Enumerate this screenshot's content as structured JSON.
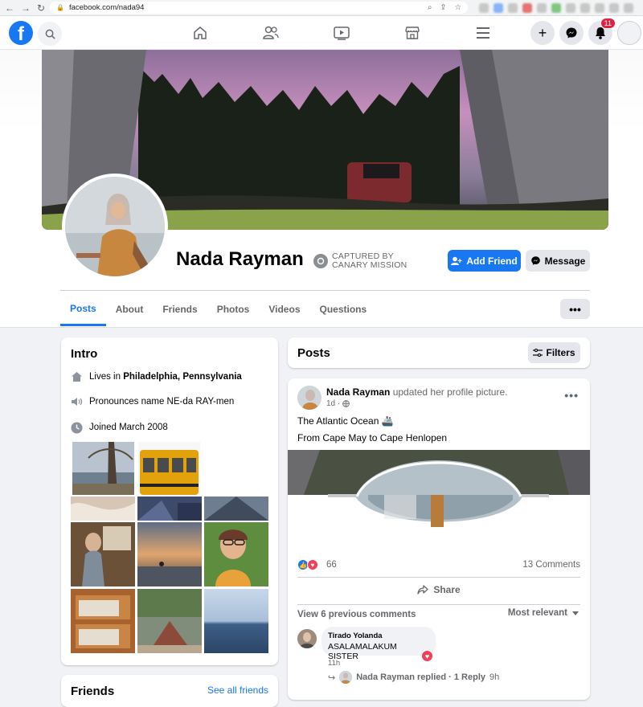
{
  "browser": {
    "url": "facebook.com/nada94"
  },
  "header": {
    "logo": "f",
    "notifications_count": "11"
  },
  "profile": {
    "name": "Nada Rayman",
    "captured_line1": "CAPTURED BY",
    "captured_line2": "CANARY MISSION",
    "add_friend_label": "Add Friend",
    "message_label": "Message"
  },
  "tabs": [
    {
      "label": "Posts",
      "active": true
    },
    {
      "label": "About"
    },
    {
      "label": "Friends"
    },
    {
      "label": "Photos"
    },
    {
      "label": "Videos"
    },
    {
      "label": "Questions"
    }
  ],
  "more_label": "•••",
  "intro": {
    "title": "Intro",
    "lives_prefix": "Lives in ",
    "lives_place": "Philadelphia, Pennsylvania",
    "pronounces": "Pronounces name NE-da RAY-men",
    "joined": "Joined March 2008"
  },
  "friends_section": {
    "title": "Friends",
    "see_all": "See all friends"
  },
  "posts": {
    "title": "Posts",
    "filters_label": "Filters"
  },
  "post": {
    "author": "Nada Rayman",
    "action": " updated her profile picture.",
    "time": "1d ·",
    "line1": "The Atlantic Ocean 🚢",
    "line2": "From Cape May to Cape Henlopen",
    "reaction_count": "66",
    "comments_count": "13 Comments",
    "share_label": "Share",
    "view_previous": "View 6 previous comments",
    "sort_label": "Most relevant",
    "comment": {
      "author": "Tirado Yolanda",
      "text": "ASALAMALAKUM SISTER",
      "time": "11h"
    },
    "reply_text": "Nada Rayman replied · 1 Reply",
    "reply_time": "9h"
  },
  "colors": {
    "accent": "#1877f2",
    "heart": "#f33e58"
  },
  "icons": [
    "home-icon",
    "friends-icon",
    "watch-icon",
    "marketplace-icon",
    "menu-icon",
    "plus-icon",
    "messenger-icon",
    "bell-icon"
  ]
}
